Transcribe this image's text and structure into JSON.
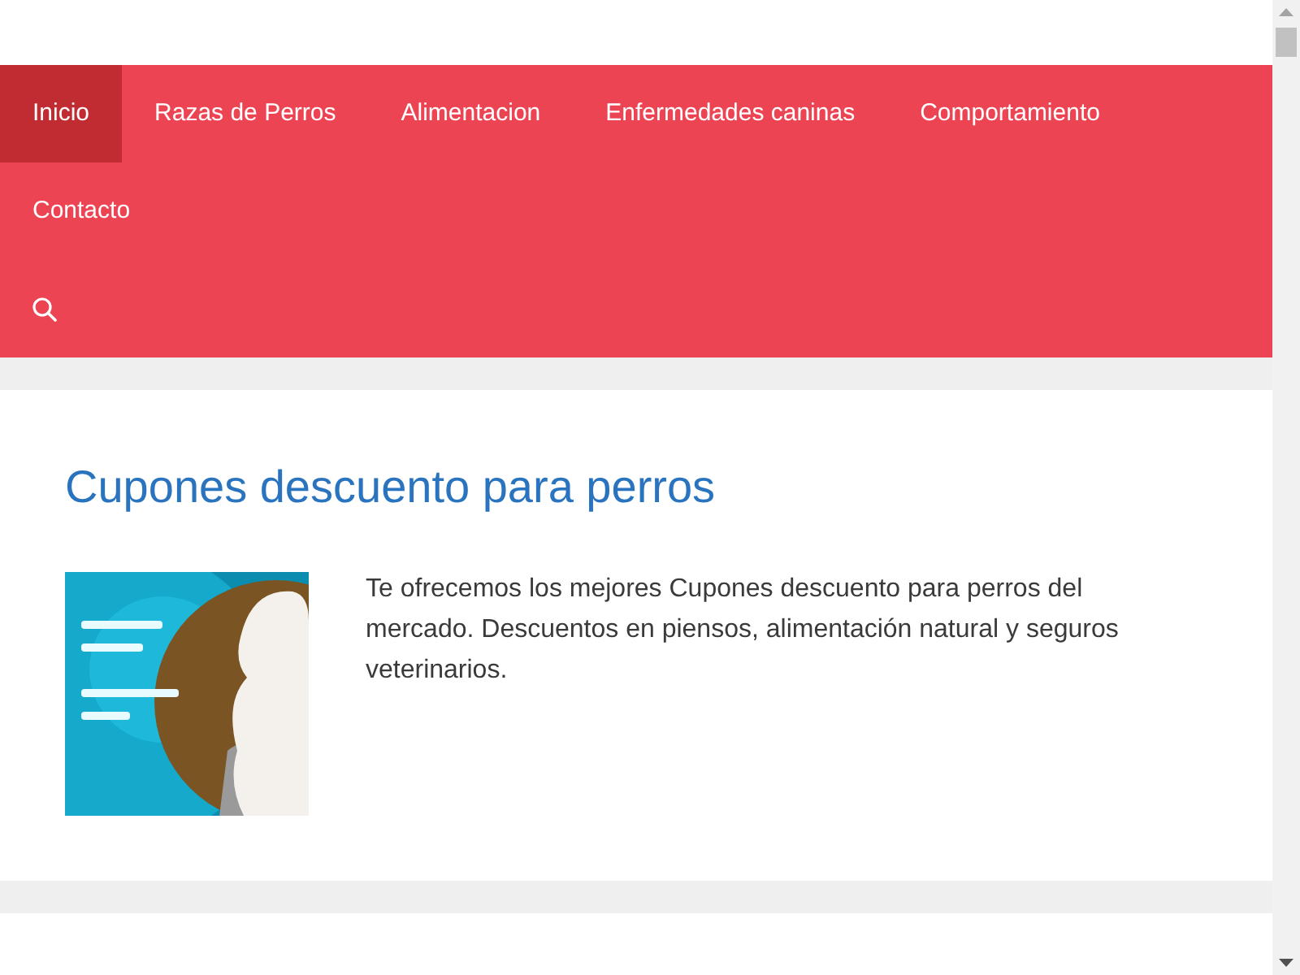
{
  "nav": {
    "items": [
      {
        "label": "Inicio",
        "selected": true
      },
      {
        "label": "Razas de Perros",
        "selected": false
      },
      {
        "label": "Alimentacion",
        "selected": false
      },
      {
        "label": "Enfermedades caninas",
        "selected": false
      },
      {
        "label": "Comportamiento",
        "selected": false
      },
      {
        "label": "Contacto",
        "selected": false
      }
    ]
  },
  "article": {
    "title": "Cupones descuento para perros",
    "excerpt": "Te ofrecemos los mejores Cupones descuento para perros del mercado. Descuentos en piensos, alimentación natural y seguros veterinarios."
  }
}
